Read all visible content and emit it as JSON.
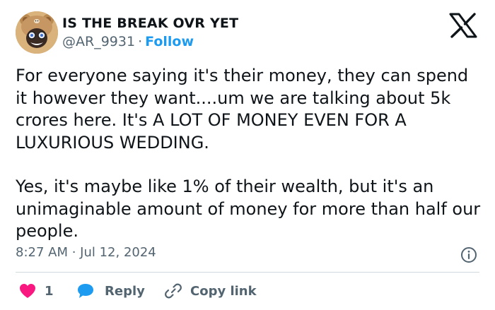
{
  "author": {
    "display_name": "IS THE BREAK OVR YET",
    "handle": "@AR_9931",
    "separator": "·",
    "follow_label": "Follow"
  },
  "tweet": {
    "paragraphs": [
      "For everyone saying it's their money, they can spend it however they want....um we are talking about 5k crores here. It's A LOT OF MONEY EVEN FOR A LUXURIOUS WEDDING.",
      "Yes, it's maybe like 1% of their wealth, but it's an unimaginable amount of money for more than half our people."
    ],
    "timestamp": "8:27 AM · Jul 12, 2024"
  },
  "actions": {
    "like_count": "1",
    "reply_label": "Reply",
    "copy_link_label": "Copy link"
  },
  "icons": {
    "platform_logo": "x-logo-icon",
    "info": "info-icon",
    "like": "heart-icon",
    "reply": "speech-bubble-icon",
    "copy_link": "link-icon"
  },
  "colors": {
    "text": "#0f1419",
    "secondary_text": "#536471",
    "accent": "#1d9bf0",
    "like": "#f91880",
    "divider": "#cfd9de"
  }
}
